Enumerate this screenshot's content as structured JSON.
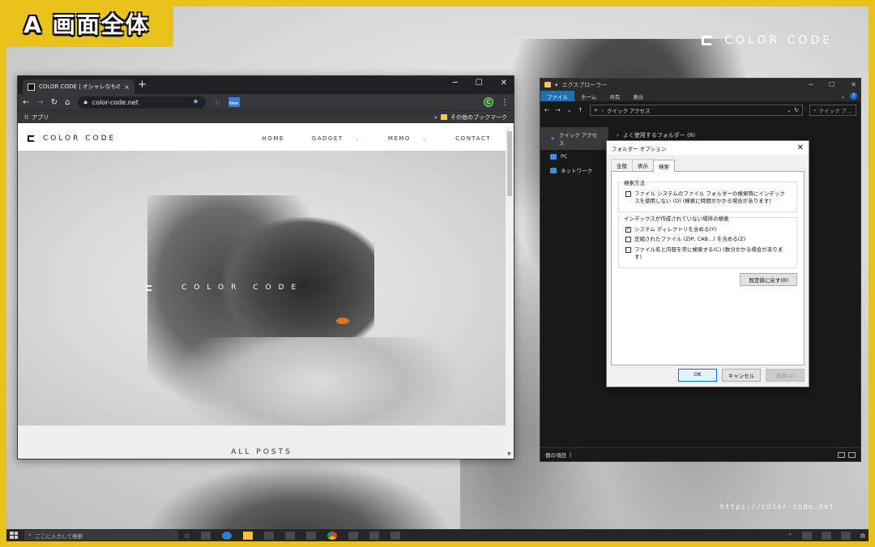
{
  "corner_label": "A 画面全体",
  "background": {
    "brand_text": "COLOR CODE",
    "url_text": "https://color-code.net"
  },
  "browser": {
    "tab_title": "COLOR CODE | オシャレなもの好きな",
    "tab_close": "×",
    "new_tab": "+",
    "window_controls": [
      "─",
      "☐",
      "✕"
    ],
    "address": "color-code.net",
    "new_badge": "New",
    "avatar_letter": "C",
    "bookmarks_apps": "アプリ",
    "bookmarks_other": "その他のブックマーク",
    "site": {
      "logo_text": "COLOR CODE",
      "nav": [
        "HOME",
        "GADGET",
        "MEMO",
        "CONTACT"
      ],
      "hero_brand": "COLOR CODE",
      "all_posts": "ALL POSTS"
    }
  },
  "explorer": {
    "title": "エクスプローラー",
    "ribbon_tabs": [
      "ファイル",
      "ホーム",
      "共有",
      "表示"
    ],
    "address_path": "クイック アクセス",
    "search_placeholder": "クイック ア...",
    "nav_items": [
      "クイック アクセス",
      "PC",
      "ネットワーク"
    ],
    "frequent_folders": "よく使用するフォルダー (8)",
    "status_count": "個の項目"
  },
  "dialog": {
    "title": "フォルダー オプション",
    "tabs": [
      "全般",
      "表示",
      "検索"
    ],
    "active_tab": "検索",
    "group1_title": "検索方法",
    "group1_option": "ファイル システムのファイル フォルダーの検索時にインデックスを使用しない (D) (検索に時間がかかる場合があります)",
    "group2_title": "インデックスが作成されていない場所の検索",
    "group2_options": [
      {
        "label": "システム ディレクトリを含める(Y)",
        "checked": true
      },
      {
        "label": "圧縮されたファイル (ZIP, CAB...) を含める(Z)",
        "checked": false
      },
      {
        "label": "ファイル名と内容を常に検索する(C) (数分かかる場合があります)",
        "checked": false
      }
    ],
    "restore_button": "既定値に戻す(R)",
    "ok_button": "OK",
    "cancel_button": "キャンセル",
    "apply_button": "適用(A)"
  },
  "taskbar": {
    "search_placeholder": "ここに入力して検索"
  }
}
